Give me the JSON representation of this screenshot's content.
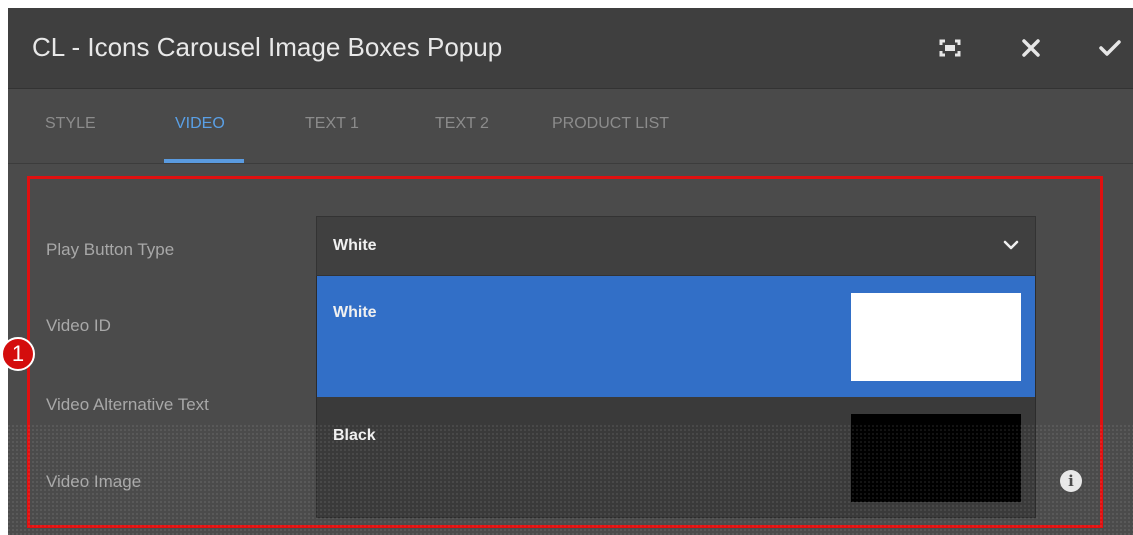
{
  "dialog": {
    "title": "CL - Icons Carousel Image Boxes Popup"
  },
  "tabs": [
    {
      "label": "STYLE",
      "active": false
    },
    {
      "label": "VIDEO",
      "active": true
    },
    {
      "label": "TEXT 1",
      "active": false
    },
    {
      "label": "TEXT 2",
      "active": false
    },
    {
      "label": "PRODUCT LIST",
      "active": false
    }
  ],
  "fields": {
    "play_button_type": "Play Button Type",
    "video_id": "Video ID",
    "video_alt_text": "Video Alternative Text",
    "video_image": "Video Image"
  },
  "select": {
    "value": "White",
    "options": [
      {
        "label": "White",
        "swatch_color": "#ffffff",
        "selected": true
      },
      {
        "label": "Black",
        "swatch_color": "#000000",
        "selected": false
      }
    ]
  },
  "annotation": {
    "callout_number": "1",
    "highlight_color": "#e01010"
  },
  "colors": {
    "accent": "#5aa0e6",
    "selected_option": "#326fc7"
  },
  "icons": {
    "fullscreen": "fullscreen-icon",
    "close": "close-icon",
    "confirm": "check-icon",
    "dropdown": "chevron-down-icon",
    "info": "info-icon"
  }
}
